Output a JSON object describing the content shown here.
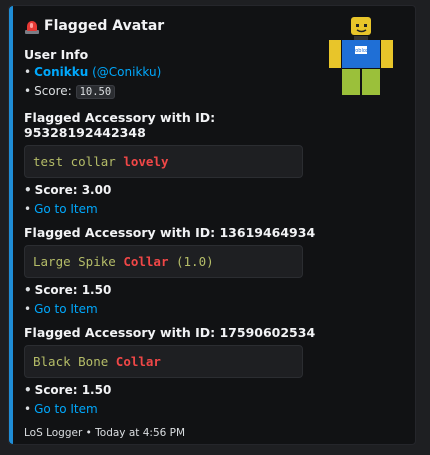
{
  "embed": {
    "title": "Flagged Avatar",
    "user_info": {
      "heading": "User Info",
      "display_name": "Conikku",
      "username": "(@Conikku)",
      "score_label": "Score:",
      "score_value": "10.50"
    },
    "accessories": [
      {
        "heading": "Flagged Accessory with ID: 95328192442348",
        "name_plain": "test collar ",
        "name_flag": "lovely",
        "name_suffix": "",
        "score": "Score: 3.00",
        "link": "Go to Item"
      },
      {
        "heading": "Flagged Accessory with ID: 13619464934",
        "name_plain": "Large Spike ",
        "name_flag": "Collar",
        "name_suffix": " (1.0)",
        "score": "Score: 1.50",
        "link": "Go to Item"
      },
      {
        "heading": "Flagged Accessory with ID: 17590602534",
        "name_plain": "Black Bone ",
        "name_flag": "Collar",
        "name_suffix": "",
        "score": "Score: 1.50",
        "link": "Go to Item"
      }
    ],
    "footer": "LoS Logger • Today at 4:56 PM",
    "accent_color": "#1f8dd6"
  },
  "icons": {
    "title_icon": "siren-icon",
    "thumbnail": "avatar-thumbnail"
  }
}
